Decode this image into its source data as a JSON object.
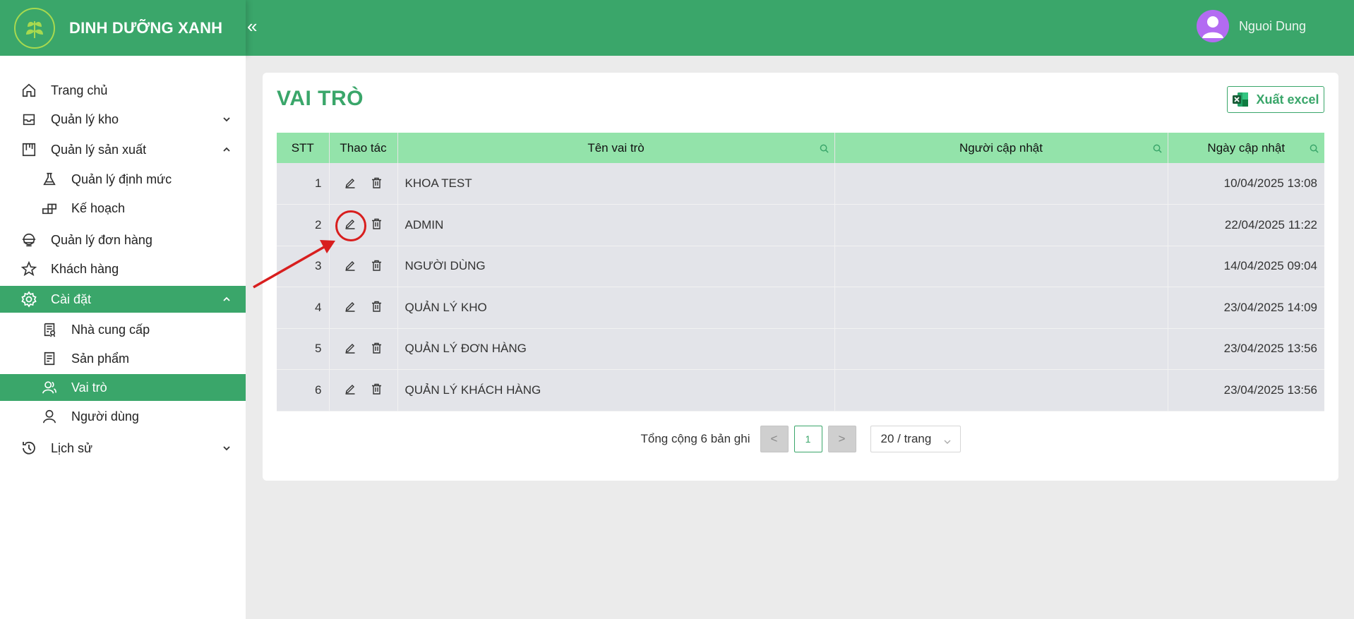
{
  "brand": {
    "name": "DINH DƯỠNG XANH",
    "collapse_symbol": "«"
  },
  "user": {
    "name": "Nguoi Dung"
  },
  "sidebar": {
    "items": [
      {
        "label": "Trang chủ",
        "icon": "home-icon"
      },
      {
        "label": "Quản lý kho",
        "icon": "inbox-icon",
        "expandable": true,
        "expanded": false
      },
      {
        "label": "Quản lý sản xuất",
        "icon": "production-icon",
        "expandable": true,
        "expanded": true
      },
      {
        "label": "Quản lý định mức",
        "icon": "flask-icon",
        "sub": true
      },
      {
        "label": "Kế hoạch",
        "icon": "plan-icon",
        "sub": true
      },
      {
        "label": "Quản lý đơn hàng",
        "icon": "order-icon"
      },
      {
        "label": "Khách hàng",
        "icon": "star-icon"
      },
      {
        "label": "Cài đặt",
        "icon": "gear-icon",
        "expandable": true,
        "expanded": true,
        "active": true
      },
      {
        "label": "Nhà cung cấp",
        "icon": "supplier-icon",
        "sub": true
      },
      {
        "label": "Sản phẩm",
        "icon": "product-icon",
        "sub": true
      },
      {
        "label": "Vai trò",
        "icon": "roles-icon",
        "sub": true,
        "active": true
      },
      {
        "label": "Người dùng",
        "icon": "user-icon",
        "sub": true
      },
      {
        "label": "Lịch sử",
        "icon": "history-icon",
        "expandable": true,
        "expanded": false
      }
    ]
  },
  "page": {
    "title": "VAI TRÒ",
    "export_label": "Xuất excel"
  },
  "table": {
    "columns": [
      "STT",
      "Thao tác",
      "Tên vai trò",
      "Người cập nhật",
      "Ngày cập nhật"
    ],
    "rows": [
      {
        "stt": "1",
        "name": "KHOA TEST",
        "updated_by": "",
        "updated_at": "10/04/2025 13:08"
      },
      {
        "stt": "2",
        "name": "ADMIN",
        "updated_by": "",
        "updated_at": "22/04/2025 11:22"
      },
      {
        "stt": "3",
        "name": "NGƯỜI DÙNG",
        "updated_by": "",
        "updated_at": "14/04/2025 09:04"
      },
      {
        "stt": "4",
        "name": "QUẢN LÝ KHO",
        "updated_by": "",
        "updated_at": "23/04/2025 14:09"
      },
      {
        "stt": "5",
        "name": "QUẢN LÝ ĐƠN HÀNG",
        "updated_by": "",
        "updated_at": "23/04/2025 13:56"
      },
      {
        "stt": "6",
        "name": "QUẢN LÝ KHÁCH HÀNG",
        "updated_by": "",
        "updated_at": "23/04/2025 13:56"
      }
    ]
  },
  "pagination": {
    "total_text": "Tổng cộng 6 bản ghi",
    "prev_symbol": "<",
    "current_page": "1",
    "next_symbol": ">",
    "page_size": "20 / trang"
  },
  "colors": {
    "primary": "#3aa66a",
    "header_bg": "#93e3aa",
    "row_bg": "#e3e4e9",
    "annotation": "#d81e1e"
  }
}
